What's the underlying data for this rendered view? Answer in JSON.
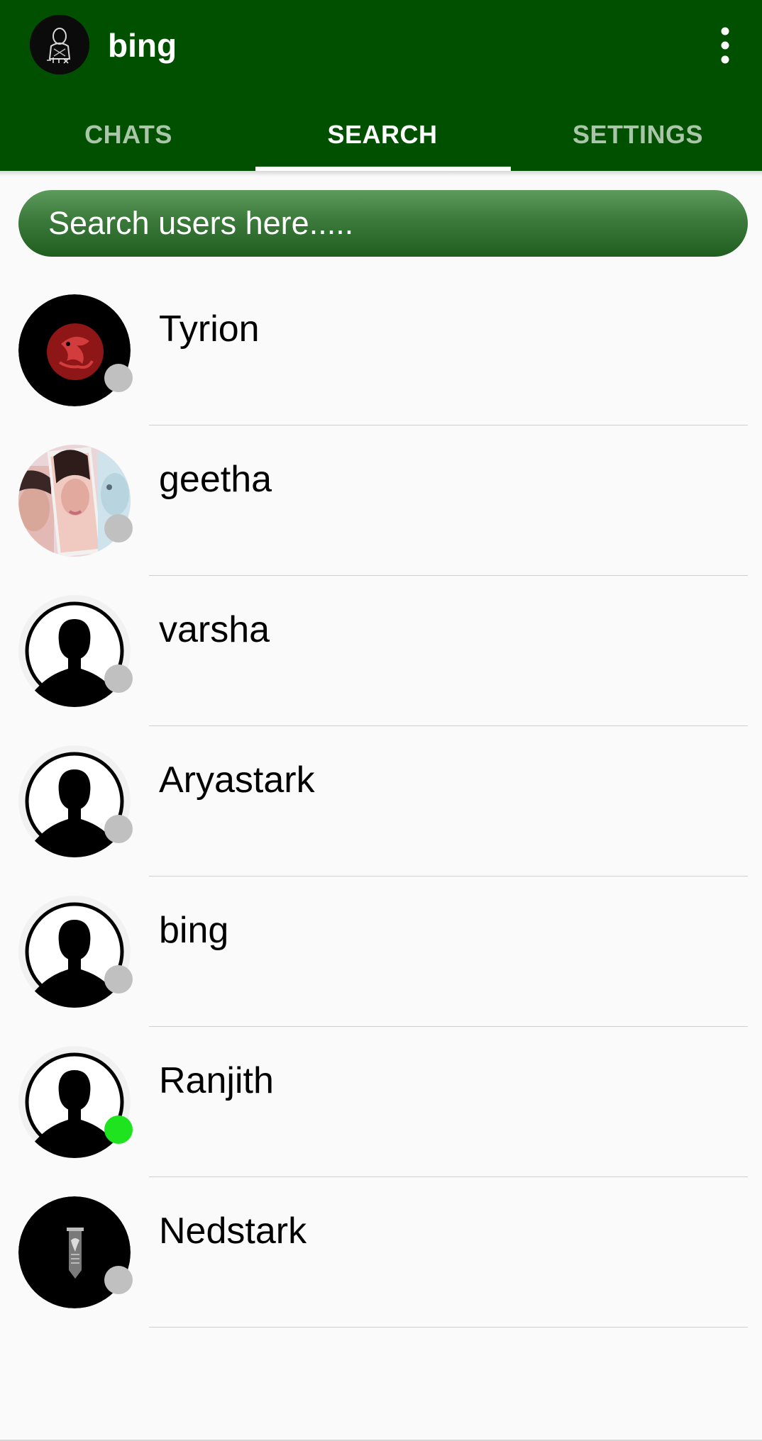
{
  "app": {
    "title": "bing",
    "accent_color": "#005000",
    "menu_icon": "more-vert-icon"
  },
  "tabs": [
    {
      "label": "CHATS",
      "active": false
    },
    {
      "label": "SEARCH",
      "active": true
    },
    {
      "label": "SETTINGS",
      "active": false
    }
  ],
  "search": {
    "placeholder": "Search users here.....",
    "value": ""
  },
  "users": [
    {
      "name": "Tyrion",
      "avatar": "dragon-sigil-avatar",
      "status": "offline"
    },
    {
      "name": "geetha",
      "avatar": "photo-collage-avatar",
      "status": "offline"
    },
    {
      "name": "varsha",
      "avatar": "default-person-avatar",
      "status": "offline"
    },
    {
      "name": "Aryastark",
      "avatar": "default-person-avatar",
      "status": "offline"
    },
    {
      "name": "bing",
      "avatar": "default-person-avatar",
      "status": "offline"
    },
    {
      "name": "Ranjith",
      "avatar": "default-person-avatar",
      "status": "online"
    },
    {
      "name": "Nedstark",
      "avatar": "banner-sigil-avatar",
      "status": "offline"
    }
  ],
  "status_colors": {
    "online": "#1ee31e",
    "offline": "#c0c0c0"
  }
}
